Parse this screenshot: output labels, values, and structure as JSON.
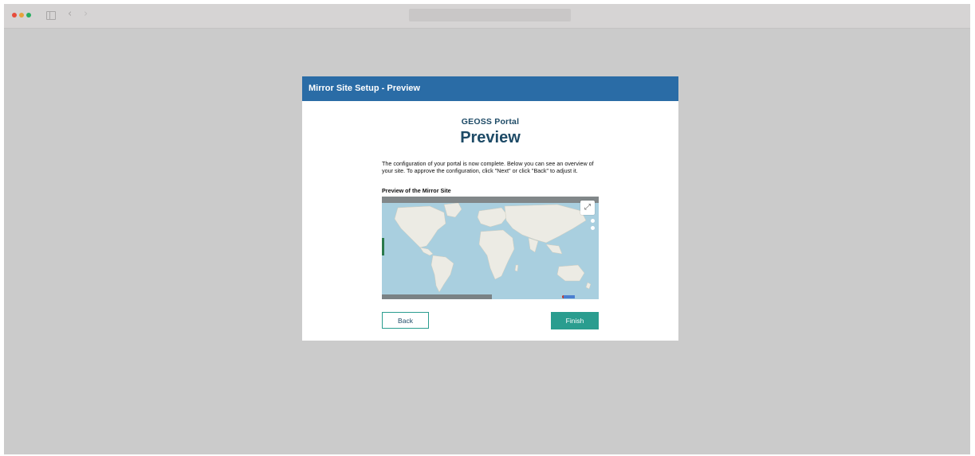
{
  "browser": {
    "back_glyph": "‹",
    "forward_glyph": "›"
  },
  "dialog": {
    "header_title": "Mirror Site Setup - Preview",
    "logo_text": "GEOSS Portal",
    "title": "Preview",
    "description": "The configuration of your portal is now complete. Below you can see an overview of your site. To approve the configuration, click \"Next\" or click \"Back\" to adjust it.",
    "preview_label": "Preview of the Mirror Site",
    "map": {
      "expand_glyph": "⤢"
    },
    "back_button": "Back",
    "finish_button": "Finish"
  },
  "colors": {
    "header": "#2a6ca6",
    "accent": "#2a9d8f",
    "title": "#1d4a66"
  }
}
